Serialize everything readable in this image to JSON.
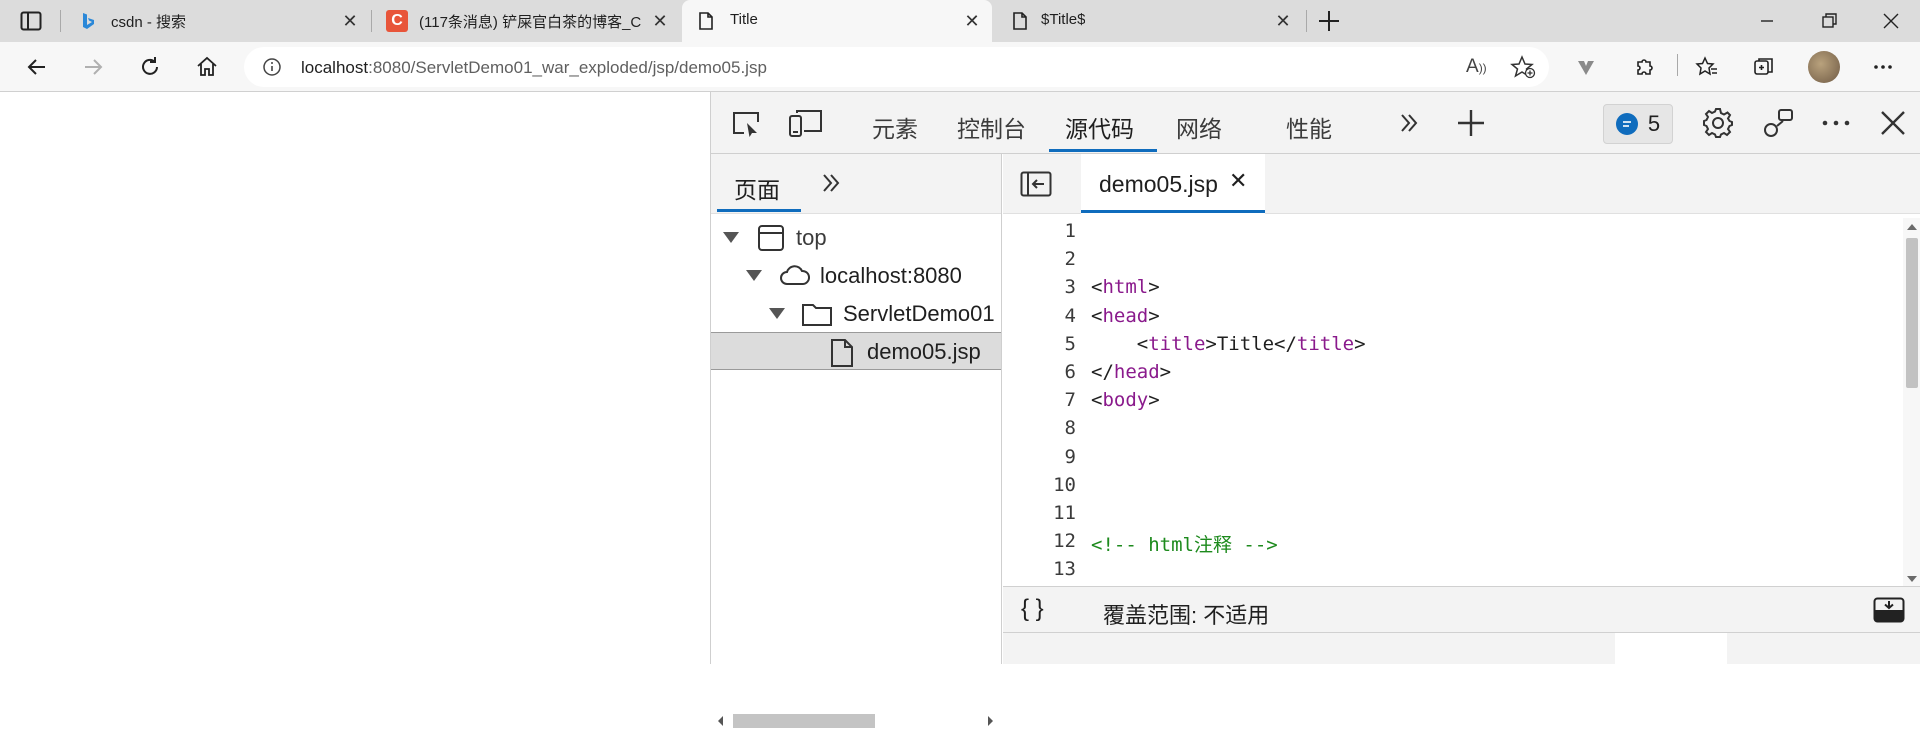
{
  "browser": {
    "tabs": [
      {
        "title": "csdn - 搜索",
        "favicon": "bing-icon",
        "active": false
      },
      {
        "title": "(117条消息) 铲屎官白茶的博客_C",
        "favicon": "csdn-icon",
        "active": false
      },
      {
        "title": "Title",
        "favicon": "page-icon",
        "active": true
      },
      {
        "title": "$Title$",
        "favicon": "page-icon",
        "active": false
      }
    ],
    "url_host": "localhost",
    "url_rest": ":8080/ServletDemo01_war_exploded/jsp/demo05.jsp"
  },
  "devtools": {
    "tabs": [
      "元素",
      "控制台",
      "源代码",
      "网络",
      "性能"
    ],
    "active_tab": "源代码",
    "issues_count": "5",
    "navigator": {
      "tab_label": "页面",
      "tree": [
        {
          "label": "top",
          "depth": 0,
          "icon": "frame-icon",
          "expanded": true
        },
        {
          "label": "localhost:8080",
          "depth": 1,
          "icon": "cloud-icon",
          "expanded": true
        },
        {
          "label": "ServletDemo01",
          "depth": 2,
          "icon": "folder-icon",
          "expanded": true
        },
        {
          "label": "demo05.jsp",
          "depth": 3,
          "icon": "file-icon",
          "selected": true
        }
      ]
    },
    "editor": {
      "file_tab": "demo05.jsp",
      "lines": [
        {
          "n": "1",
          "text": ""
        },
        {
          "n": "2",
          "text": ""
        },
        {
          "n": "3",
          "text": "<html>"
        },
        {
          "n": "4",
          "text": "<head>"
        },
        {
          "n": "5",
          "text": "    <title>Title</title>"
        },
        {
          "n": "6",
          "text": "</head>"
        },
        {
          "n": "7",
          "text": "<body>"
        },
        {
          "n": "8",
          "text": ""
        },
        {
          "n": "9",
          "text": ""
        },
        {
          "n": "10",
          "text": ""
        },
        {
          "n": "11",
          "text": ""
        },
        {
          "n": "12",
          "text": "<!-- html注释 -->"
        },
        {
          "n": "13",
          "text": ""
        }
      ],
      "status_braces": "{ }",
      "coverage": "覆盖范围: 不适用"
    }
  },
  "colors": {
    "accent": "#0f6cbd",
    "tag": "#8a1a8c",
    "comment": "#1d8a1d",
    "csdn": "#e8553a"
  }
}
